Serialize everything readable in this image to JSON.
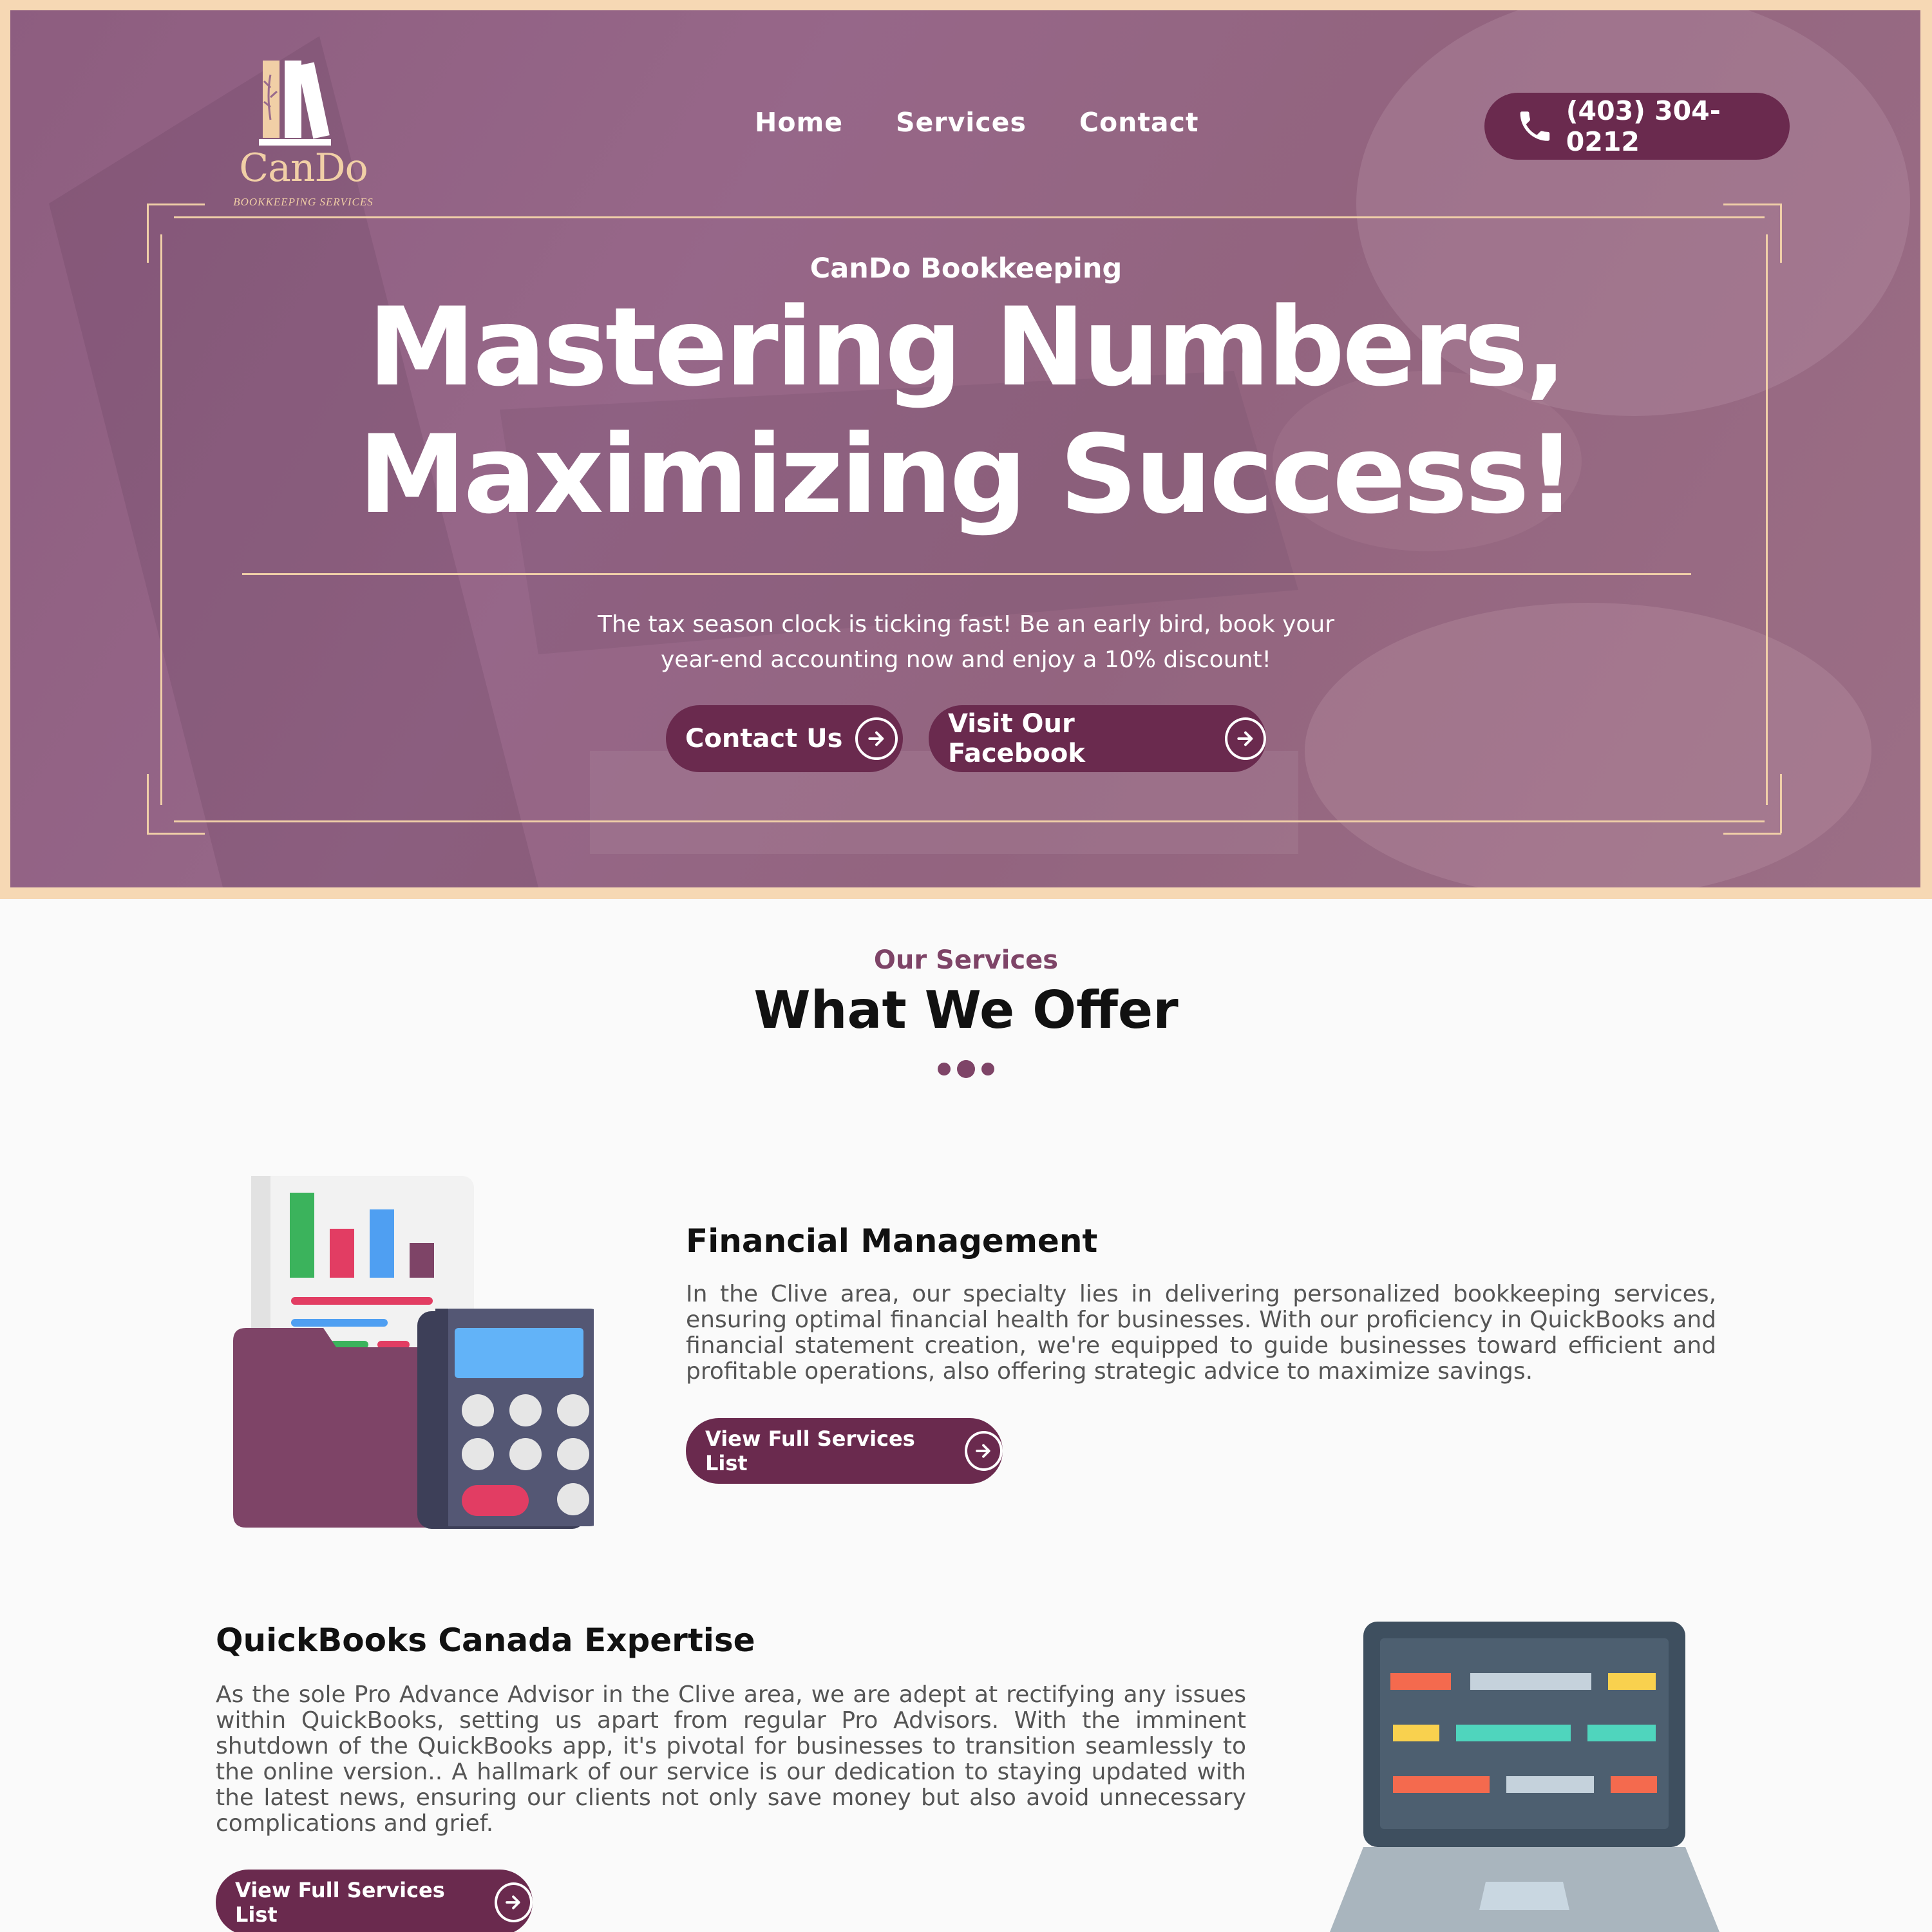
{
  "brand": {
    "name": "CanDo",
    "tagline": "BOOKKEEPING SERVICES",
    "cream": "#f6d8b4",
    "plum": "#6a2a4e",
    "accent": "#7e4467"
  },
  "nav": {
    "home": "Home",
    "services": "Services",
    "contact": "Contact"
  },
  "phone": {
    "icon": "phone-icon",
    "number": "(403) 304-0212"
  },
  "hero": {
    "eyebrow": "CanDo Bookkeeping",
    "headline_line1": "Mastering Numbers,",
    "headline_line2": "Maximizing Success!",
    "subtitle": "The tax season clock is ticking fast! Be an early bird, book your year-end accounting now and enjoy a 10% discount!",
    "btn_contact": "Contact Us",
    "btn_facebook": "Visit Our Facebook",
    "btn_icon": "arrow-right-circle-icon"
  },
  "services": {
    "eyebrow": "Our Services",
    "title": "What We Offer",
    "items": [
      {
        "title": "Financial Management",
        "text": "In the Clive area, our specialty lies in delivering personalized bookkeeping services, ensuring optimal financial health for businesses. With our proficiency in QuickBooks and financial statement creation, we're equipped to guide businesses toward efficient and profitable operations, also offering strategic advice to maximize savings.",
        "button": "View Full Services List",
        "illustration": "folder-calculator-chart-icon"
      },
      {
        "title": "QuickBooks Canada Expertise",
        "text": "As the sole Pro Advance Advisor in the Clive area, we are adept at rectifying any issues within QuickBooks, setting us apart from regular Pro Advisors. With the imminent shutdown of the QuickBooks app, it's pivotal for businesses to transition seamlessly to the online version.. A hallmark of our service is our dedication to staying updated with the latest news, ensuring our clients not only save money but also avoid unnecessary complications and grief.",
        "button": "View Full Services List",
        "illustration": "laptop-code-icon"
      }
    ]
  }
}
